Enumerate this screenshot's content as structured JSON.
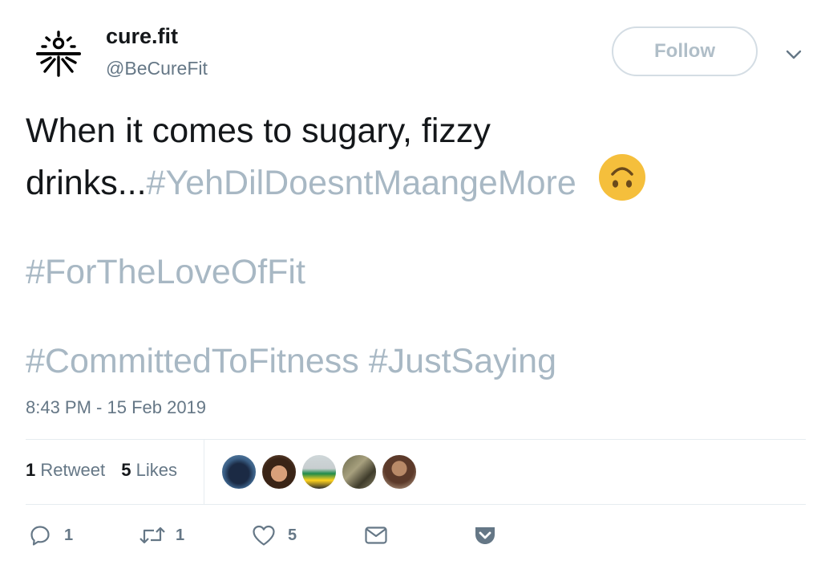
{
  "account": {
    "name": "cure.fit",
    "handle": "@BeCureFit"
  },
  "follow_label": "Follow",
  "tweet": {
    "line1": "When it comes to sugary, fizzy",
    "line2_text": "drinks...",
    "line2_hashtag": "#YehDilDoesntMaangeMore",
    "emoji": "upside-down-face-emoji",
    "hashtag_line3": "#ForTheLoveOfFit",
    "hashtag_line4": "#CommittedToFitness #JustSaying"
  },
  "timestamp": "8:43 PM - 15 Feb 2019",
  "stats": {
    "retweet_count": "1",
    "retweet_label": "Retweet",
    "like_count": "5",
    "like_label": "Likes"
  },
  "actions": {
    "reply_count": "1",
    "retweet_count": "1",
    "like_count": "5"
  },
  "colors": {
    "hashtag": "#a8b8c4",
    "text": "#14171a",
    "secondary": "#657786",
    "emoji": "#f5bf3c"
  },
  "icons": [
    "curefit-logo",
    "chevron-down-icon",
    "upside-down-face-emoji",
    "reply-icon",
    "retweet-icon",
    "heart-icon",
    "envelope-icon",
    "pocket-icon"
  ]
}
